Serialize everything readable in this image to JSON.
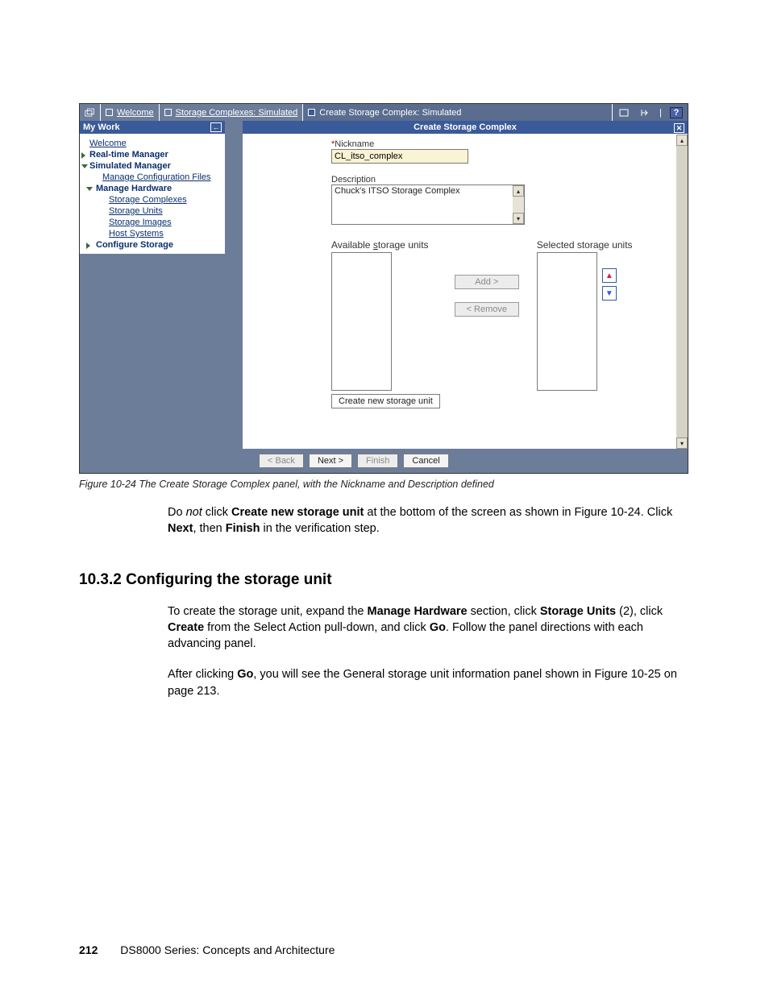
{
  "tabs": {
    "welcome": "Welcome",
    "storage_complexes": "Storage Complexes: Simulated",
    "create_complex": "Create Storage Complex: Simulated"
  },
  "sidebar": {
    "header": "My Work",
    "items": [
      "Welcome",
      "Real-time Manager",
      "Simulated Manager",
      "Manage Configuration Files",
      "Manage Hardware",
      "Storage Complexes",
      "Storage Units",
      "Storage Images",
      "Host Systems",
      "Configure Storage"
    ]
  },
  "main": {
    "title": "Create Storage Complex",
    "nickname_label": "Nickname",
    "nickname_value": "CL_itso_complex",
    "description_label": "Description",
    "description_value": "Chuck's ITSO Storage Complex",
    "available_label_pre": "Available ",
    "available_label_u": "s",
    "available_label_post": "torage units",
    "selected_label": "Selected storage units",
    "add_btn": "Add >",
    "remove_btn": "< Remove",
    "create_unit": "Create new storage unit",
    "back": "< Back",
    "next": "Next >",
    "finish": "Finish",
    "cancel": "Cancel"
  },
  "caption": "Figure 10-24   The Create Storage Complex panel, with the Nickname and Description defined",
  "para1": {
    "pre": "Do ",
    "not": "not",
    "mid1": " click ",
    "b1": "Create new storage unit",
    "mid2": " at the bottom of the screen as shown in Figure 10-24. Click ",
    "b2": "Next",
    "mid3": ", then ",
    "b3": "Finish",
    "post": " in the verification step."
  },
  "heading": "10.3.2  Configuring the storage unit",
  "para2": {
    "pre": "To create the storage unit, expand the ",
    "b1": "Manage Hardware",
    "mid1": " section, click ",
    "b2": "Storage Units",
    "mid2": " (2), click ",
    "b3": "Create",
    "mid3": " from the Select Action pull-down, and click ",
    "b4": "Go",
    "post": ". Follow the panel directions with each advancing panel."
  },
  "para3": {
    "pre": "After clicking ",
    "b1": "Go",
    "post": ", you will see the General storage unit information panel shown in Figure 10-25 on page 213."
  },
  "footer": {
    "page": "212",
    "title": "DS8000 Series: Concepts and Architecture"
  }
}
